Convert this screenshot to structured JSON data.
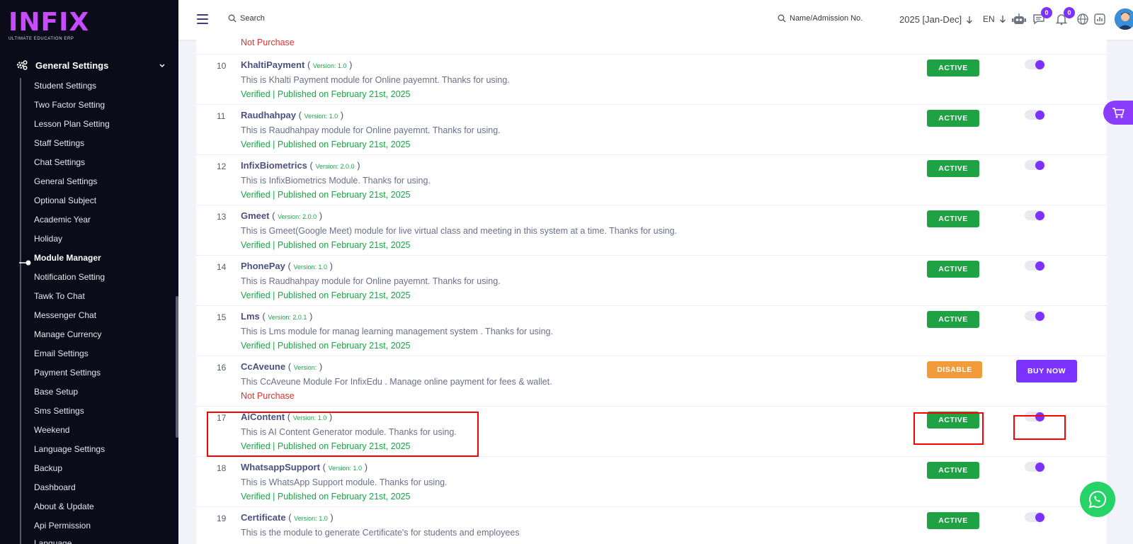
{
  "brand": {
    "name": "INFIX",
    "tagline": "ULTIMATE EDUCATION ERP"
  },
  "sidebar": {
    "group_label": "General Settings",
    "items": [
      {
        "label": "Student Settings",
        "active": false
      },
      {
        "label": "Two Factor Setting",
        "active": false
      },
      {
        "label": "Lesson Plan Setting",
        "active": false
      },
      {
        "label": "Staff Settings",
        "active": false
      },
      {
        "label": "Chat Settings",
        "active": false
      },
      {
        "label": "General Settings",
        "active": false
      },
      {
        "label": "Optional Subject",
        "active": false
      },
      {
        "label": "Academic Year",
        "active": false
      },
      {
        "label": "Holiday",
        "active": false
      },
      {
        "label": "Module Manager",
        "active": true
      },
      {
        "label": "Notification Setting",
        "active": false
      },
      {
        "label": "Tawk To Chat",
        "active": false
      },
      {
        "label": "Messenger Chat",
        "active": false
      },
      {
        "label": "Manage Currency",
        "active": false
      },
      {
        "label": "Email Settings",
        "active": false
      },
      {
        "label": "Payment Settings",
        "active": false
      },
      {
        "label": "Base Setup",
        "active": false
      },
      {
        "label": "Sms Settings",
        "active": false
      },
      {
        "label": "Weekend",
        "active": false
      },
      {
        "label": "Language Settings",
        "active": false
      },
      {
        "label": "Backup",
        "active": false
      },
      {
        "label": "Dashboard",
        "active": false
      },
      {
        "label": "About & Update",
        "active": false
      },
      {
        "label": "Api Permission",
        "active": false
      },
      {
        "label": "Language",
        "active": false
      }
    ]
  },
  "topbar": {
    "search_label": "Search",
    "admission_search_label": "Name/Admission No.",
    "academic_year": "2025 [Jan-Dec]",
    "language": "EN",
    "messages_count": "0",
    "notifications_count": "0"
  },
  "top_row": {
    "status_text": "Not Purchase"
  },
  "modules": [
    {
      "num": "10",
      "name": "KhaltiPayment",
      "version": "Version: 1.0",
      "description": "This is Khalti Payment module for Online payemnt. Thanks for using.",
      "status_text": "Verified | Published on February 21st, 2025",
      "status_type": "verified",
      "button": "ACTIVE",
      "button_type": "active",
      "toggle": true
    },
    {
      "num": "11",
      "name": "Raudhahpay",
      "version": "Version: 1.0",
      "description": "This is Raudhahpay module for Online payemnt. Thanks for using.",
      "status_text": "Verified | Published on February 21st, 2025",
      "status_type": "verified",
      "button": "ACTIVE",
      "button_type": "active",
      "toggle": true
    },
    {
      "num": "12",
      "name": "InfixBiometrics",
      "version": "Version: 2.0.0",
      "description": "This is InfixBiometrics Module. Thanks for using.",
      "status_text": "Verified | Published on February 21st, 2025",
      "status_type": "verified",
      "button": "ACTIVE",
      "button_type": "active",
      "toggle": true
    },
    {
      "num": "13",
      "name": "Gmeet",
      "version": "Version: 2.0.0",
      "description": "This is Gmeet(Google Meet) module for live virtual class and meeting in this system at a time. Thanks for using.",
      "status_text": "Verified | Published on February 21st, 2025",
      "status_type": "verified",
      "button": "ACTIVE",
      "button_type": "active",
      "toggle": true
    },
    {
      "num": "14",
      "name": "PhonePay",
      "version": "Version: 1.0",
      "description": "This is Raudhahpay module for Online payemnt. Thanks for using.",
      "status_text": "Verified | Published on February 21st, 2025",
      "status_type": "verified",
      "button": "ACTIVE",
      "button_type": "active",
      "toggle": true
    },
    {
      "num": "15",
      "name": "Lms",
      "version": "Version: 2.0.1",
      "description": "This is Lms module for manag learning management system . Thanks for using.",
      "status_text": "Verified | Published on February 21st, 2025",
      "status_type": "verified",
      "button": "ACTIVE",
      "button_type": "active",
      "toggle": true
    },
    {
      "num": "16",
      "name": "CcAveune",
      "version": "Version:",
      "description": "This CcAveune Module For InfixEdu . Manage online payment for fees & wallet.",
      "status_text": "Not Purchase",
      "status_type": "not-purchased",
      "button": "DISABLE",
      "button_type": "disable",
      "toggle": false,
      "buy_label": "BUY NOW"
    },
    {
      "num": "17",
      "name": "AiContent",
      "version": "Version: 1.0",
      "description": "This is AI Content Generator module. Thanks for using.",
      "status_text": "Verified | Published on February 21st, 2025",
      "status_type": "verified",
      "button": "ACTIVE",
      "button_type": "active",
      "toggle": true,
      "highlighted": true
    },
    {
      "num": "18",
      "name": "WhatsappSupport",
      "version": "Version: 1.0",
      "description": "This is WhatsApp Support module. Thanks for using.",
      "status_text": "Verified | Published on February 21st, 2025",
      "status_type": "verified",
      "button": "ACTIVE",
      "button_type": "active",
      "toggle": true
    },
    {
      "num": "19",
      "name": "Certificate",
      "version": "Version: 1.0",
      "description": "This is the module to generate Certificate's for students and employees",
      "status_text": "",
      "status_type": "verified",
      "button": "ACTIVE",
      "button_type": "active",
      "toggle": true
    }
  ],
  "colors": {
    "accent": "#7c32ff",
    "active_green": "#1fa244",
    "disable_orange": "#f29b3a",
    "verified_green": "#1aa545",
    "not_purchase_red": "#e0312f",
    "highlight_red": "#ff0000",
    "sidebar_bg": "#0b0b1a"
  },
  "icons": [
    "hamburger-icon",
    "search-icon",
    "arrow-down-icon",
    "robot-icon",
    "chat-icon",
    "bell-icon",
    "globe-icon",
    "chart-icon",
    "cart-icon",
    "whatsapp-icon",
    "gear-icon",
    "chevron-down-icon"
  ]
}
